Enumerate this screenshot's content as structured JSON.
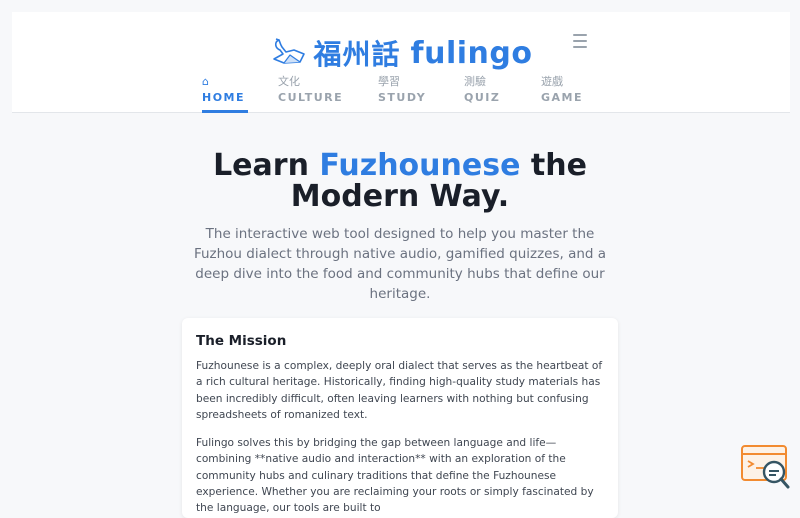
{
  "header": {
    "logo_glyphs": "福州話",
    "logo_text": "fulingo",
    "menu_icon": "hamburger-menu-icon"
  },
  "nav": {
    "items": [
      {
        "icon": "⌂",
        "label": "HOME",
        "active": true
      },
      {
        "icon": "文化",
        "label": "CULTURE",
        "active": false
      },
      {
        "icon": "學習",
        "label": "STUDY",
        "active": false
      },
      {
        "icon": "測驗",
        "label": "QUIZ",
        "active": false
      },
      {
        "icon": "遊戲",
        "label": "GAME",
        "active": false
      }
    ]
  },
  "hero": {
    "title_pre": "Learn ",
    "title_accent": "Fuzhounese",
    "title_post": " the",
    "title_line2": "Modern Way.",
    "subtitle": "The interactive web tool designed to help you master the Fuzhou dialect through native audio, gamified quizzes, and a deep dive into the food and community hubs that define our heritage."
  },
  "mission": {
    "title": "The Mission",
    "para1": "Fuzhounese is a complex, deeply oral dialect that serves as the heartbeat of a rich cultural heritage. Historically, finding high-quality study materials has been incredibly difficult, often leaving learners with nothing but confusing spreadsheets of romanized text.",
    "para2": "Fulingo solves this by bridging the gap between language and life—combining **native audio and interaction** with an exploration of the community hubs and culinary traditions that define the Fuzhounese experience. Whether you are reclaiming your roots or simply fascinated by the language, our tools are built to"
  },
  "colors": {
    "accent": "#2f7de1",
    "floating_accent": "#f28b30"
  },
  "floating": {
    "icon": "search-feedback-icon"
  }
}
